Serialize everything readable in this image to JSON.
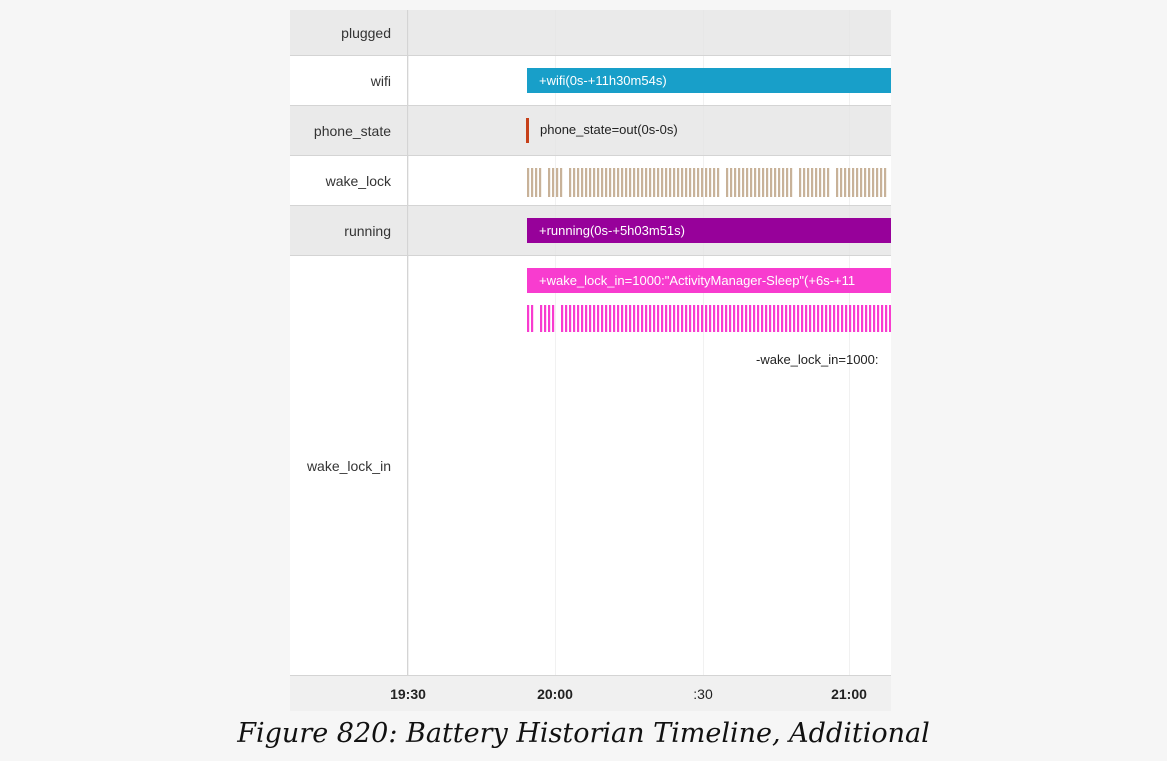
{
  "rows": [
    {
      "label": "plugged"
    },
    {
      "label": "wifi"
    },
    {
      "label": "phone_state"
    },
    {
      "label": "wake_lock"
    },
    {
      "label": "running"
    },
    {
      "label": "wake_lock_in"
    }
  ],
  "bars": {
    "wifi": "+wifi(0s-+11h30m54s)",
    "phone_state": "phone_state=out(0s-0s)",
    "running": "+running(0s-+5h03m51s)",
    "wake_lock_in_top": "+wake_lock_in=1000:\"ActivityManager-Sleep\"(+6s-+11",
    "wake_lock_in_bottom": "-wake_lock_in=1000:"
  },
  "axis": {
    "ticks": [
      {
        "label": "19:30",
        "bold": true
      },
      {
        "label": "20:00",
        "bold": true
      },
      {
        "label": ":30",
        "bold": false
      },
      {
        "label": "21:00",
        "bold": true
      }
    ]
  },
  "caption": "Figure 820: Battery Historian Timeline, Additional",
  "colors": {
    "wifi": "#189fc9",
    "phone_state_marker": "#c64019",
    "wake_lock": "#c8b299",
    "running": "#97019a",
    "wake_lock_in": "#f83ccf"
  }
}
